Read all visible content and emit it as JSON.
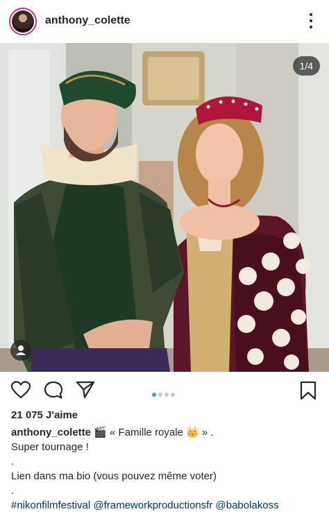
{
  "header": {
    "username": "anthony_colette",
    "more_icon": "more-vertical-icon"
  },
  "photo": {
    "page_counter": "1/4",
    "current_image": 1,
    "total_images": 4,
    "description_icon": "user-tag-icon"
  },
  "actions": {
    "like_icon": "heart-icon",
    "comment_icon": "comment-icon",
    "share_icon": "paper-plane-icon",
    "save_icon": "bookmark-icon",
    "carousel_dots": 4,
    "active_dot": 1
  },
  "likes_text": "21 075 J'aime",
  "caption": {
    "username": "anthony_colette",
    "title": "🎬 « Famille royale 👑 » .",
    "line2": "Super tournage !",
    "line3": ".",
    "line4": "Lien dans ma bio (vous pouvez même voter)",
    "line5": ".",
    "hashtags": "#nikonfilmfestival @frameworkproductionsfr @babolakoss"
  },
  "colors": {
    "accent_blue": "#3897f0",
    "link_blue": "#003569",
    "text": "#262626"
  }
}
